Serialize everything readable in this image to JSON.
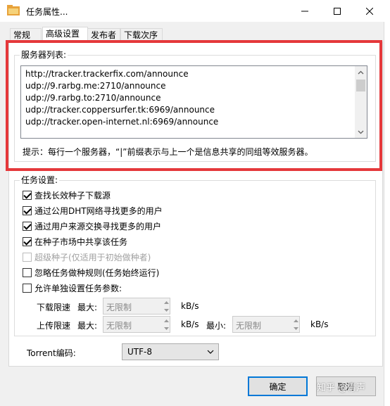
{
  "window": {
    "title": "任务属性...",
    "icons": {
      "app": "utorrent-icon",
      "minimize": "minimize-icon",
      "maximize": "maximize-icon",
      "close": "close-icon"
    }
  },
  "tabs": [
    {
      "label": "常规",
      "active": false
    },
    {
      "label": "高级设置",
      "active": true
    },
    {
      "label": "发布者",
      "active": false
    },
    {
      "label": "下载次序",
      "active": false
    }
  ],
  "servers": {
    "group_title": "服务器列表:",
    "lines": [
      "http://tracker.trackerfix.com/announce",
      "udp://9.rarbg.me:2710/announce",
      "udp://9.rarbg.to:2710/announce",
      "udp://tracker.coppersurfer.tk:6969/announce",
      "udp://tracker.open-internet.nl:6969/announce"
    ],
    "hint": "提示：每行一个服务器，“|”前缀表示与上一个是信息共享的同组等效服务器。"
  },
  "task": {
    "group_title": "任务设置:",
    "options": [
      {
        "label": "查找长效种子下载源",
        "checked": true,
        "disabled": false
      },
      {
        "label": "通过公用DHT网络寻找更多的用户",
        "checked": true,
        "disabled": false
      },
      {
        "label": "通过用户来源交换寻找更多的用户",
        "checked": true,
        "disabled": false
      },
      {
        "label": "在种子市场中共享该任务",
        "checked": true,
        "disabled": false
      },
      {
        "label": "超级种子(仅适用于初始做种者)",
        "checked": false,
        "disabled": true
      },
      {
        "label": "忽略任务做种规则(任务始终运行)",
        "checked": false,
        "disabled": false
      },
      {
        "label": "允许单独设置任务参数:",
        "checked": false,
        "disabled": false
      }
    ],
    "download_limit_label": "下载限速",
    "upload_limit_label": "上传限速",
    "max_label": "最大:",
    "min_label": "最小:",
    "unit": "kB/s",
    "download_max": "无限制",
    "upload_max": "无限制",
    "upload_min": "无限制"
  },
  "encoding": {
    "label": "Torrent编码:",
    "value": "UTF-8"
  },
  "buttons": {
    "ok": "确定",
    "cancel": "取消"
  },
  "watermark": "知乎 @青声",
  "colors": {
    "highlight": "#e5383b",
    "default_button_border": "#0078d7"
  }
}
